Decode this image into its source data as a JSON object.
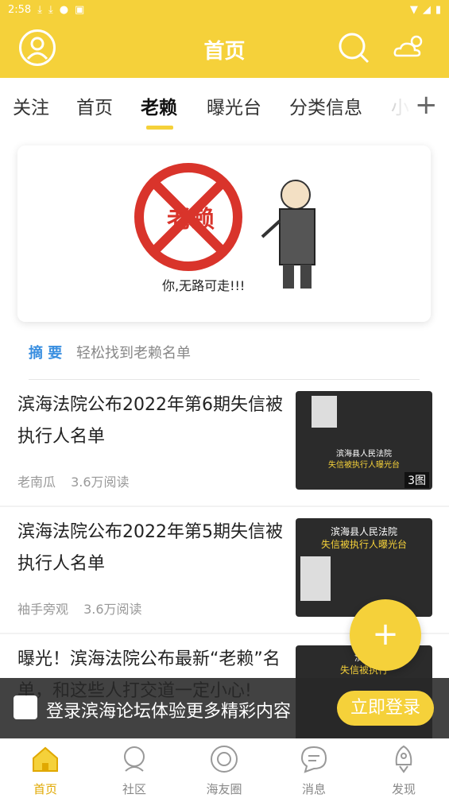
{
  "status_bar": {
    "time": "2:58"
  },
  "header": {
    "title": "首页"
  },
  "tabs": [
    {
      "label": "关注"
    },
    {
      "label": "首页"
    },
    {
      "label": "老赖"
    },
    {
      "label": "曝光台"
    },
    {
      "label": "分类信息"
    },
    {
      "label": "小"
    }
  ],
  "banner": {
    "image_text": "老赖",
    "caption": "你,无路可走!!!"
  },
  "summary": {
    "label": "摘 要",
    "text": "轻松找到老赖名单"
  },
  "news": [
    {
      "title": "滨海法院公布2022年第6期失信被执行人名单",
      "author": "老南瓜",
      "reads": "3.6万阅读",
      "thumb_line1": "滨海县人民法院",
      "thumb_line2": "失信被执行人曝光台",
      "pic_count": "3图"
    },
    {
      "title": "滨海法院公布2022年第5期失信被执行人名单",
      "author": "袖手旁观",
      "reads": "3.6万阅读",
      "thumb_line1": "滨海县人民法院",
      "thumb_line2": "失信被执行人曝光台"
    },
    {
      "title": "曝光！滨海法院公布最新“老赖”名单，和这些人打交道一定小心!",
      "thumb_line1": "滨海",
      "thumb_line2": "失信被执行"
    }
  ],
  "fab": {
    "label": "+"
  },
  "login_bar": {
    "text": "登录滨海论坛体验更多精彩内容",
    "button": "立即登录"
  },
  "bottom_nav": [
    {
      "label": "首页",
      "icon": "home-icon"
    },
    {
      "label": "社区",
      "icon": "community-icon"
    },
    {
      "label": "海友圈",
      "icon": "circle-icon"
    },
    {
      "label": "消息",
      "icon": "message-icon"
    },
    {
      "label": "发现",
      "icon": "rocket-icon"
    }
  ],
  "colors": {
    "accent": "#f5d13a",
    "summary_label": "#3a8fe0",
    "nav_active": "#e0a800"
  }
}
